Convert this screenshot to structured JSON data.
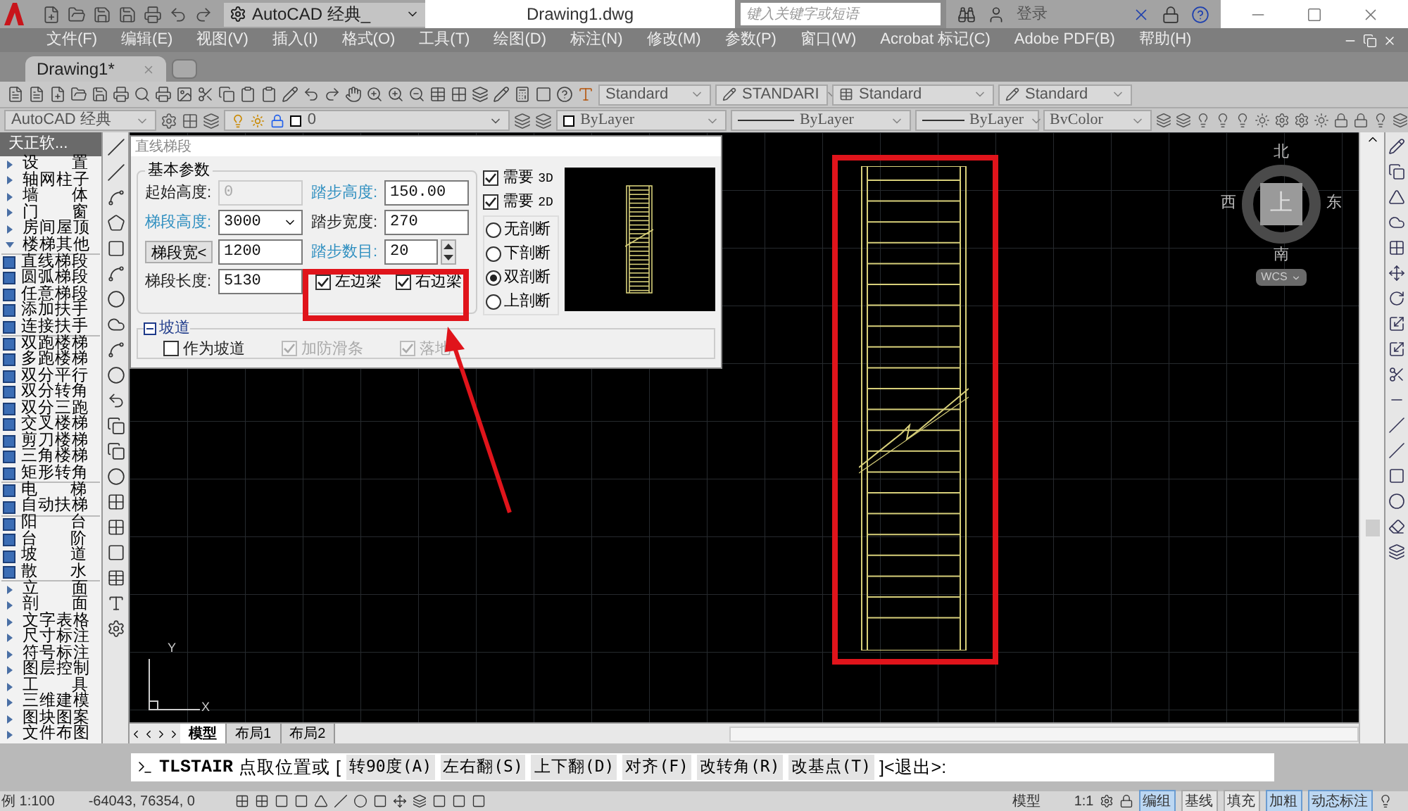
{
  "title_bar": {
    "workspace": "AutoCAD 经典_",
    "title": "Drawing1.dwg",
    "search": {
      "placeholder": "键入关键字或短语"
    },
    "login": "登录"
  },
  "menu": [
    "文件(F)",
    "编辑(E)",
    "视图(V)",
    "插入(I)",
    "格式(O)",
    "工具(T)",
    "绘图(D)",
    "标注(N)",
    "修改(M)",
    "参数(P)",
    "窗口(W)",
    "Acrobat 标记(C)",
    "Adobe PDF(B)",
    "帮助(H)"
  ],
  "doc_tabs": [
    {
      "label": "Drawing1*",
      "selected": true
    }
  ],
  "styles_toolbar": {
    "styles": [
      "Standard",
      "STANDARI",
      "Standard",
      "Standard"
    ]
  },
  "properties_toolbar": {
    "workspace": "AutoCAD 经典",
    "layer": "0",
    "color_setting": "ByLayer",
    "linetype": "ByLayer",
    "lineweight": "ByLayer",
    "plot_style": "BvColor"
  },
  "sidebar": {
    "title": "天正软...",
    "items": [
      {
        "label": "设 置",
        "expanded": false
      },
      {
        "label": "轴网柱子",
        "expanded": false
      },
      {
        "label": "墙 体",
        "expanded": false
      },
      {
        "label": "门 窗",
        "expanded": false
      },
      {
        "label": "房间屋顶",
        "expanded": false
      },
      {
        "label": "楼梯其他",
        "expanded": true,
        "children": [
          {
            "kind": "group",
            "children": [
              {
                "label": "直线梯段"
              },
              {
                "label": "圆弧梯段"
              },
              {
                "label": "任意梯段"
              },
              {
                "label": "添加扶手"
              },
              {
                "label": "连接扶手"
              }
            ]
          },
          {
            "kind": "group",
            "children": [
              {
                "label": "双跑楼梯"
              },
              {
                "label": "多跑楼梯"
              },
              {
                "label": "双分平行"
              },
              {
                "label": "双分转角"
              },
              {
                "label": "双分三跑"
              },
              {
                "label": "交叉楼梯"
              },
              {
                "label": "剪刀楼梯"
              },
              {
                "label": "三角楼梯"
              },
              {
                "label": "矩形转角"
              }
            ]
          },
          {
            "kind": "group",
            "children": [
              {
                "label": "电 梯"
              },
              {
                "label": "自动扶梯"
              }
            ]
          },
          {
            "kind": "group",
            "children": [
              {
                "label": "阳 台"
              },
              {
                "label": "台 阶"
              },
              {
                "label": "坡 道"
              },
              {
                "label": "散 水"
              }
            ]
          }
        ]
      },
      {
        "label": "立 面",
        "expanded": false
      },
      {
        "label": "剖 面",
        "expanded": false
      },
      {
        "label": "文字表格",
        "expanded": false
      },
      {
        "label": "尺寸标注",
        "expanded": false
      },
      {
        "label": "符号标注",
        "expanded": false
      },
      {
        "label": "图层控制",
        "expanded": false
      },
      {
        "label": "工 具",
        "expanded": false
      },
      {
        "label": "三维建模",
        "expanded": false
      },
      {
        "label": "图块图案",
        "expanded": false
      },
      {
        "label": "文件布图",
        "expanded": false
      }
    ]
  },
  "dialog": {
    "title": "直线梯段",
    "basic": {
      "title": "基本参数",
      "fields_left": [
        {
          "label": "起始高度:",
          "value": "0",
          "kind": "text",
          "disabled": true,
          "highlighted": false
        },
        {
          "label": "梯段高度:",
          "value": "3000",
          "kind": "dropdown",
          "disabled": false,
          "highlighted": true
        },
        {
          "label": "梯段宽<",
          "value": "1200",
          "kind": "button",
          "disabled": false
        },
        {
          "label": "梯段长度:",
          "value": "5130",
          "kind": "text",
          "disabled": false,
          "highlighted": false
        }
      ],
      "fields_right": [
        {
          "label": "踏步高度:",
          "value": "150.00",
          "kind": "text",
          "disabled": false,
          "highlighted": true
        },
        {
          "label": "踏步宽度:",
          "value": "270",
          "kind": "text",
          "disabled": false,
          "highlighted": false
        },
        {
          "label": "踏步数目:",
          "value": "20",
          "kind": "spinner",
          "disabled": false,
          "highlighted": true
        }
      ],
      "beams": [
        {
          "label": "左边梁",
          "checked": true
        },
        {
          "label": "右边梁",
          "checked": true
        }
      ]
    },
    "needs": [
      {
        "label": "需要",
        "suffix": "3D",
        "checked": true
      },
      {
        "label": "需要",
        "suffix": "2D",
        "checked": true
      }
    ],
    "breaks": [
      {
        "label": "无剖断",
        "selected": false
      },
      {
        "label": "下剖断",
        "selected": false
      },
      {
        "label": "双剖断",
        "selected": true
      },
      {
        "label": "上剖断",
        "selected": false
      }
    ],
    "ramp": {
      "title": "坡道",
      "expanded": true,
      "options": [
        {
          "label": "作为坡道",
          "checked": false,
          "disabled": false
        },
        {
          "label": "加防滑条",
          "checked": true,
          "disabled": true
        },
        {
          "label": "落地",
          "checked": true,
          "disabled": true
        }
      ]
    }
  },
  "viewcube": {
    "north": "北",
    "east": "东",
    "south": "南",
    "west": "西",
    "top": "上",
    "ucs": "WCS"
  },
  "ucs_icon": {
    "x": "X",
    "y": "Y"
  },
  "layout_tabs": [
    {
      "label": "模型",
      "selected": true
    },
    {
      "label": "布局1",
      "selected": false
    },
    {
      "label": "布局2",
      "selected": false
    }
  ],
  "command_line": {
    "command": "TLSTAIR",
    "prompt": "点取位置或",
    "open": "[",
    "options": [
      "转90度(A)",
      "左右翻(S)",
      "上下翻(D)",
      "对齐(F)",
      "改转角(R)",
      "改基点(T)"
    ],
    "close": "]<退出>:"
  },
  "status_bar": {
    "scale": "例 1:100",
    "coordinates": "-64043, 76354, 0",
    "space": "模型",
    "annotation_scale": "1:1",
    "toggles": [
      {
        "label": "编组",
        "on": true
      },
      {
        "label": "基线",
        "on": false
      },
      {
        "label": "填充",
        "on": false
      },
      {
        "label": "加粗",
        "on": true
      },
      {
        "label": "动态标注",
        "on": true
      }
    ]
  }
}
